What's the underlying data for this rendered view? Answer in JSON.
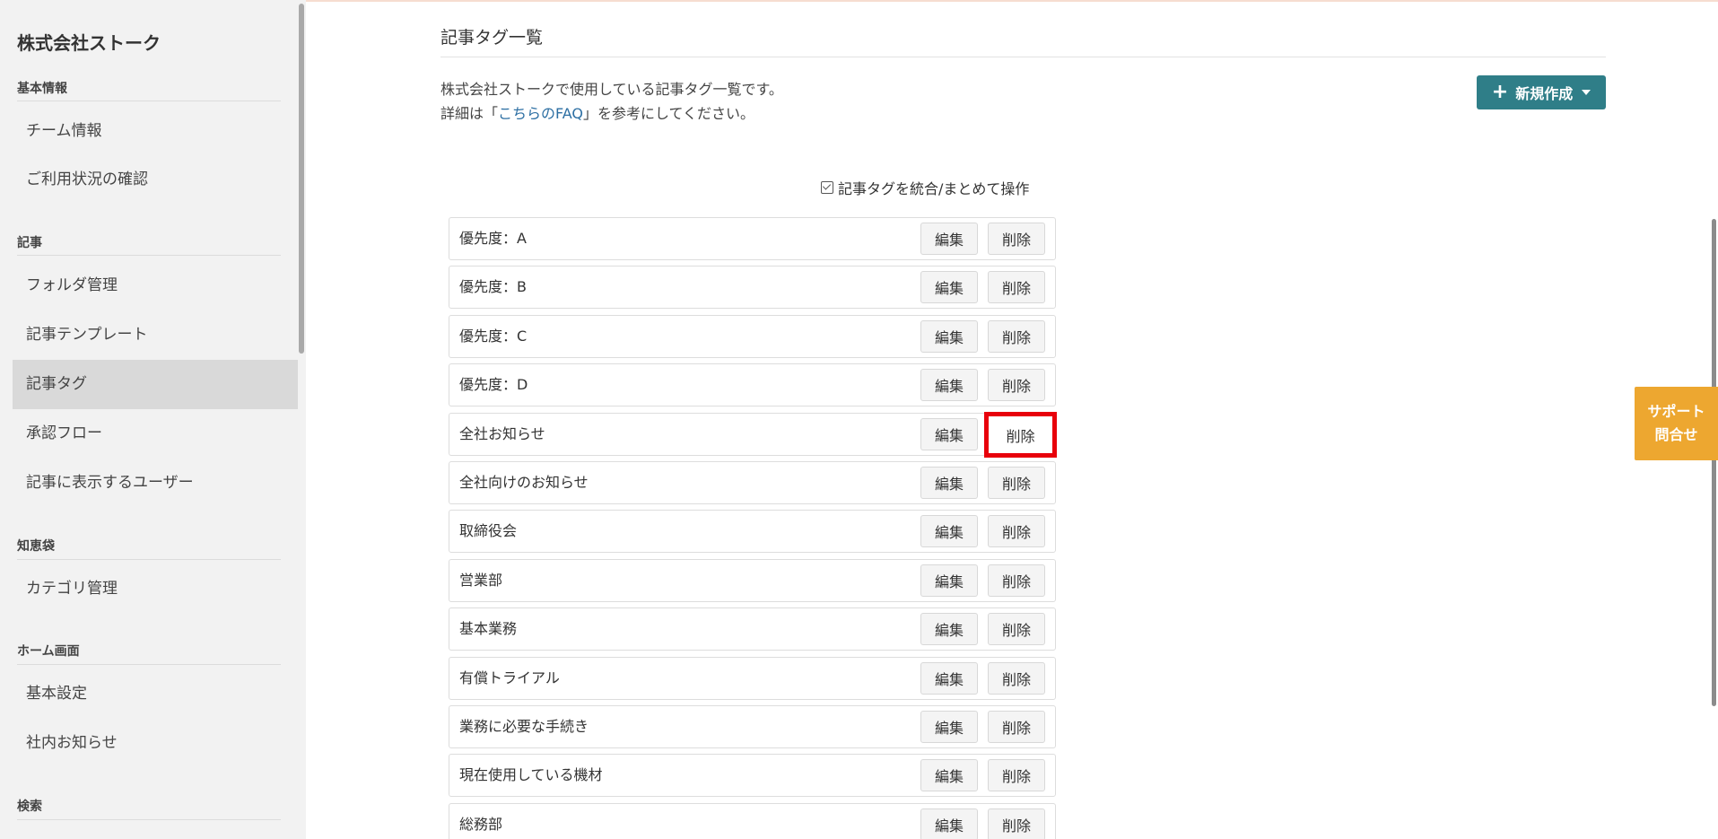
{
  "sidebar": {
    "company": "株式会社ストーク",
    "sections": [
      {
        "label": "基本情報",
        "items": [
          "チーム情報",
          "ご利用状況の確認"
        ]
      },
      {
        "label": "記事",
        "items": [
          "フォルダ管理",
          "記事テンプレート",
          "記事タグ",
          "承認フロー",
          "記事に表示するユーザー"
        ]
      },
      {
        "label": "知恵袋",
        "items": [
          "カテゴリ管理"
        ]
      },
      {
        "label": "ホーム画面",
        "items": [
          "基本設定",
          "社内お知らせ"
        ]
      },
      {
        "label": "検索",
        "items": []
      }
    ],
    "active_item": "記事タグ"
  },
  "main": {
    "title": "記事タグ一覧",
    "description_line1": "株式会社ストークで使用している記事タグ一覧です。",
    "description_line2_prefix": "詳細は「",
    "description_link": "こちらのFAQ",
    "description_line2_suffix": "」を参考にしてください。",
    "new_button_label": "新規作成",
    "merge_label": "記事タグを統合/まとめて操作",
    "edit_label": "編集",
    "delete_label": "削除",
    "tags": [
      "優先度：A",
      "優先度：B",
      "優先度：C",
      "優先度：D",
      "全社お知らせ",
      "全社向けのお知らせ",
      "取締役会",
      "営業部",
      "基本業務",
      "有償トライアル",
      "業務に必要な手続き",
      "現在使用している機材",
      "総務部"
    ],
    "highlighted_row": 4
  },
  "support": {
    "line1": "サポート",
    "line2": "問合せ",
    "color": "#eda730"
  },
  "colors": {
    "accent": "#2f7e88",
    "highlight": "#e8000b",
    "link": "#2d6fa3"
  }
}
